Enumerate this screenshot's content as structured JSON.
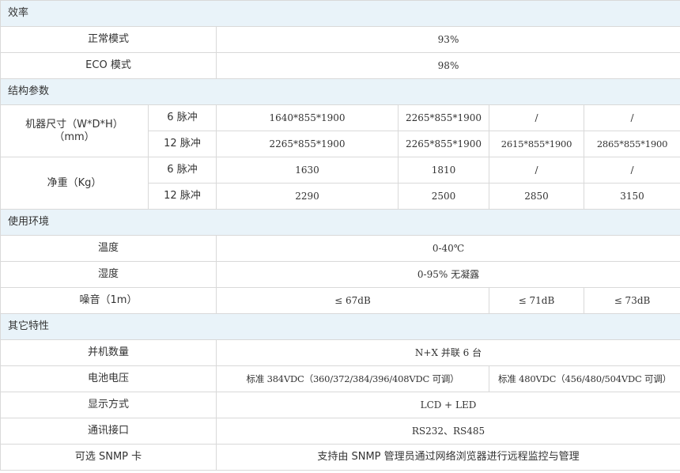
{
  "efficiency": {
    "section": "效率",
    "normal_label": "正常模式",
    "normal_value": "93%",
    "eco_label": "ECO 模式",
    "eco_value": "98%"
  },
  "structure": {
    "section": "结构参数",
    "size_label": "机器尺寸（W*D*H）（mm）",
    "weight_label": "净重（Kg）",
    "pulse6": "6 脉冲",
    "pulse12": "12 脉冲",
    "size_6": [
      "1640*855*1900",
      "2265*855*1900",
      "/",
      "/"
    ],
    "size_12": [
      "2265*855*1900",
      "2265*855*1900",
      "2615*855*1900",
      "2865*855*1900"
    ],
    "weight_6": [
      "1630",
      "1810",
      "/",
      "/"
    ],
    "weight_12": [
      "2290",
      "2500",
      "2850",
      "3150"
    ]
  },
  "environment": {
    "section": "使用环境",
    "temp_label": "温度",
    "temp_value": "0-40℃",
    "humidity_label": "湿度",
    "humidity_value": "0-95% 无凝露",
    "noise_label": "噪音（1m）",
    "noise_values": [
      "≤ 67dB",
      "≤ 71dB",
      "≤ 73dB"
    ]
  },
  "other": {
    "section": "其它特性",
    "parallel_label": "并机数量",
    "parallel_value": "N+X 并联 6 台",
    "battery_label": "电池电压",
    "battery_value_1": "标准 384VDC（360/372/384/396/408VDC 可调）",
    "battery_value_2": "标准 480VDC（456/480/504VDC 可调）",
    "display_label": "显示方式",
    "display_value": "LCD + LED",
    "comm_label": "通讯接口",
    "comm_value": "RS232、RS485",
    "snmp_label": "可选 SNMP 卡",
    "snmp_value": "支持由 SNMP 管理员通过网络浏览器进行远程监控与管理"
  }
}
